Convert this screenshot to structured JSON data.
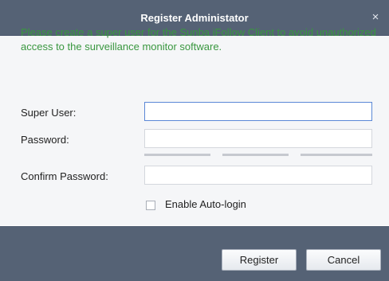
{
  "window": {
    "title": "Register Administator",
    "close_glyph": "×",
    "close_icon": "close-icon"
  },
  "intro": {
    "text": "Please create a super user for the Sunba iFollow Client to avoid unauthorized access to the surveillance monitor software."
  },
  "form": {
    "super_user_label": "Super User:",
    "super_user_value": "",
    "password_label": "Password:",
    "password_value": "",
    "password_strength_segments": 3,
    "confirm_password_label": "Confirm Password:",
    "confirm_password_value": "",
    "auto_login_label": "Enable Auto-login",
    "auto_login_checked": false
  },
  "buttons": {
    "register_label": "Register",
    "cancel_label": "Cancel"
  },
  "colors": {
    "title_bar": "#556275",
    "intro_text": "#39973f",
    "focus_border": "#5b88d6"
  }
}
